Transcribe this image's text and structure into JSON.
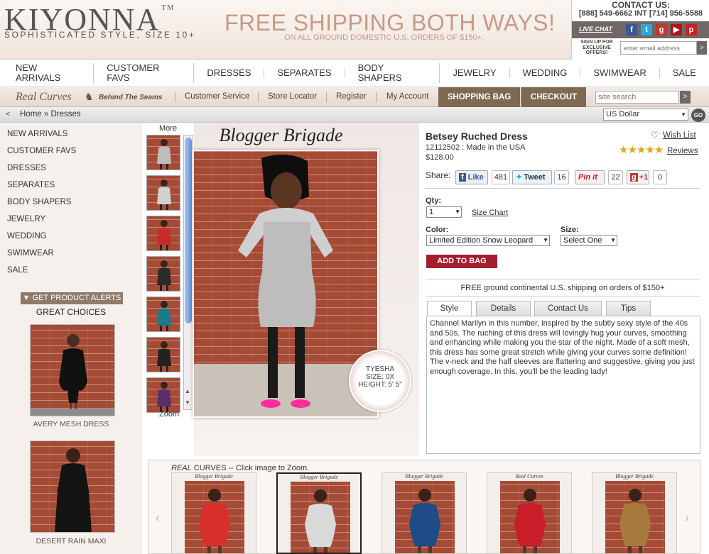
{
  "header": {
    "logo": "KIYONNA",
    "logo_tm": "TM",
    "tagline": "SOPHISTICATED STYLE, SIZE 10+",
    "promo_title": "FREE SHIPPING BOTH WAYS!",
    "promo_subtitle": "ON ALL GROUND DOMESTIC U.S. ORDERS OF $150+.",
    "contact_label": "CONTACT US:",
    "contact_phone": "[888] 549-6662 INT [714] 956-5588",
    "live_chat": "LIVE CHAT",
    "signup_text": "SIGN UP FOR EXCLUSIVE OFFERS!",
    "email_placeholder": "enter email address"
  },
  "main_nav": [
    "NEW ARRIVALS",
    "CUSTOMER FAVS",
    "DRESSES",
    "SEPARATES",
    "BODY SHAPERS",
    "JEWELRY",
    "WEDDING",
    "SWIMWEAR",
    "SALE"
  ],
  "sub_nav": {
    "real_curves": "Real Curves",
    "behind_seams": "Behind The Seams",
    "links": [
      "Customer Service",
      "Store Locator",
      "Register",
      "My Account"
    ],
    "shopping_bag": "SHOPPING BAG",
    "checkout": "CHECKOUT",
    "search_placeholder": "site search"
  },
  "breadcrumb": {
    "back": "<",
    "path": "Home » Dresses",
    "currency": "US Dollar",
    "go": "GO"
  },
  "sidebar": {
    "links": [
      "NEW ARRIVALS",
      "CUSTOMER FAVS",
      "DRESSES",
      "SEPARATES",
      "BODY SHAPERS",
      "JEWELRY",
      "WEDDING",
      "SWIMWEAR",
      "SALE"
    ],
    "alerts_button": "GET PRODUCT ALERTS",
    "great_choices": "GREAT CHOICES",
    "cards": [
      {
        "label": "AVERY MESH DRESS"
      },
      {
        "label": "DESERT RAIN MAXI"
      }
    ]
  },
  "gallery_viewer": {
    "more": "More",
    "zoom": "Zoom",
    "brigade_title": "Blogger Brigade",
    "model_name": "TYESHA",
    "model_size": "SIZE:  0X",
    "model_height": "HEIGHT:  5' 5\""
  },
  "product": {
    "name": "Betsey Ruched Dress",
    "sku_line": "12112502 : Made in the USA",
    "price": "$128.00",
    "wishlist": "Wish List",
    "stars": "★★★★★",
    "reviews": "Reviews",
    "share_label": "Share:",
    "like": "Like",
    "like_count": "481",
    "tweet": "Tweet",
    "tweet_count": "16",
    "pinit": "Pin it",
    "pin_count": "22",
    "plus_one": "+1",
    "plus_count": "0",
    "qty_label": "Qty:",
    "qty_value": "1",
    "size_chart": "Size Chart",
    "color_label": "Color:",
    "color_value": "Limited Edition Snow Leopard",
    "size_label": "Size:",
    "size_value": "Select One",
    "add_to_bag": "ADD TO BAG",
    "shipping_note": "FREE ground continental U.S. shipping on orders of $150+",
    "tabs": [
      "Style",
      "Details",
      "Contact Us",
      "Tips"
    ],
    "description": "Channel Marilyn in this number, inspired by the subtly sexy style of the 40s and 50s. The ruching of this dress will lovingly hug your curves, smoothing and enhancing while making you the star of the night. Made of a soft mesh, this dress has some great stretch while giving your curves some definition! The v-neck and the half sleeves are flattering and suggestive, giving you just enough coverage. In this, you'll be the leading lady!"
  },
  "gallery": {
    "caption_italic": "REAL",
    "caption_rest": " CURVES -- Click image to Zoom.",
    "items": [
      {
        "title": "Blogger Brigade",
        "dress_color": "#d8302b"
      },
      {
        "title": "Blogger Brigade",
        "dress_color": "#d9d9d9"
      },
      {
        "title": "Blogger Brigade",
        "dress_color": "#1d4c86"
      },
      {
        "title": "Real Curves",
        "dress_color": "#c91d2a"
      },
      {
        "title": "Blogger Brigade",
        "dress_color": "#a7793c"
      }
    ]
  },
  "thumb_colors": [
    "#bdbdbd",
    "#d0d0d0",
    "#c92a2a",
    "#2b2b2b",
    "#1b7a86",
    "#222222",
    "#5b2d6e"
  ],
  "colors": {
    "accent_brown": "#7e6953",
    "add_to_bag_red": "#a41e2f",
    "star_gold": "#e8a516"
  }
}
